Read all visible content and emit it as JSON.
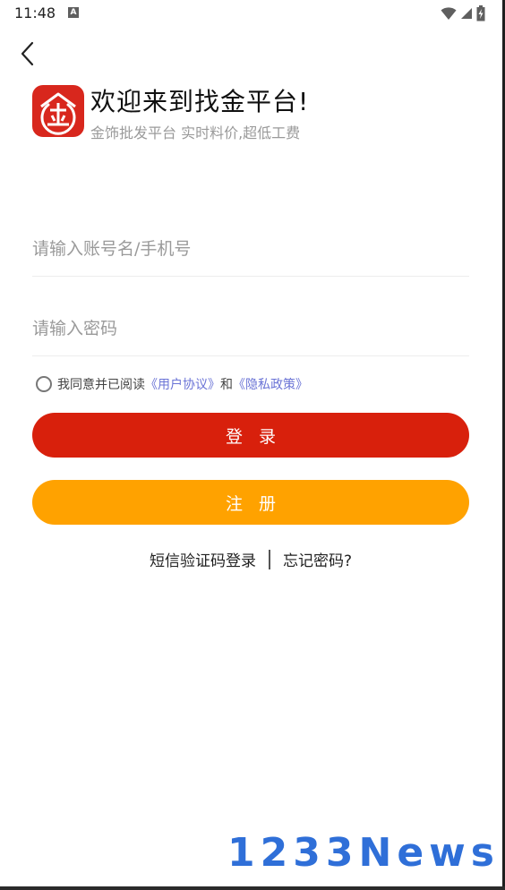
{
  "status_bar": {
    "time": "11:48",
    "notification_icon": "a-icon",
    "icons": [
      "wifi-icon",
      "signal-icon",
      "battery-icon"
    ]
  },
  "header": {
    "logo_char": "金",
    "title": "欢迎来到找金平台!",
    "subtitle": "金饰批发平台 实时料价,超低工费"
  },
  "form": {
    "username_placeholder": "请输入账号名/手机号",
    "username_value": "",
    "password_placeholder": "请输入密码",
    "password_value": "",
    "agreement_prefix": "我同意并已阅读",
    "user_agreement_link": "《用户协议》",
    "agreement_and": "和",
    "privacy_policy_link": "《隐私政策》",
    "login_label": "登录",
    "register_label": "注册"
  },
  "bottom_links": {
    "sms_login": "短信验证码登录",
    "forgot_password": "忘记密码?"
  },
  "watermark": "1233News",
  "colors": {
    "login": "#d8200c",
    "register": "#ffa200",
    "link": "#6b74d6",
    "logo": "#d8271d"
  }
}
